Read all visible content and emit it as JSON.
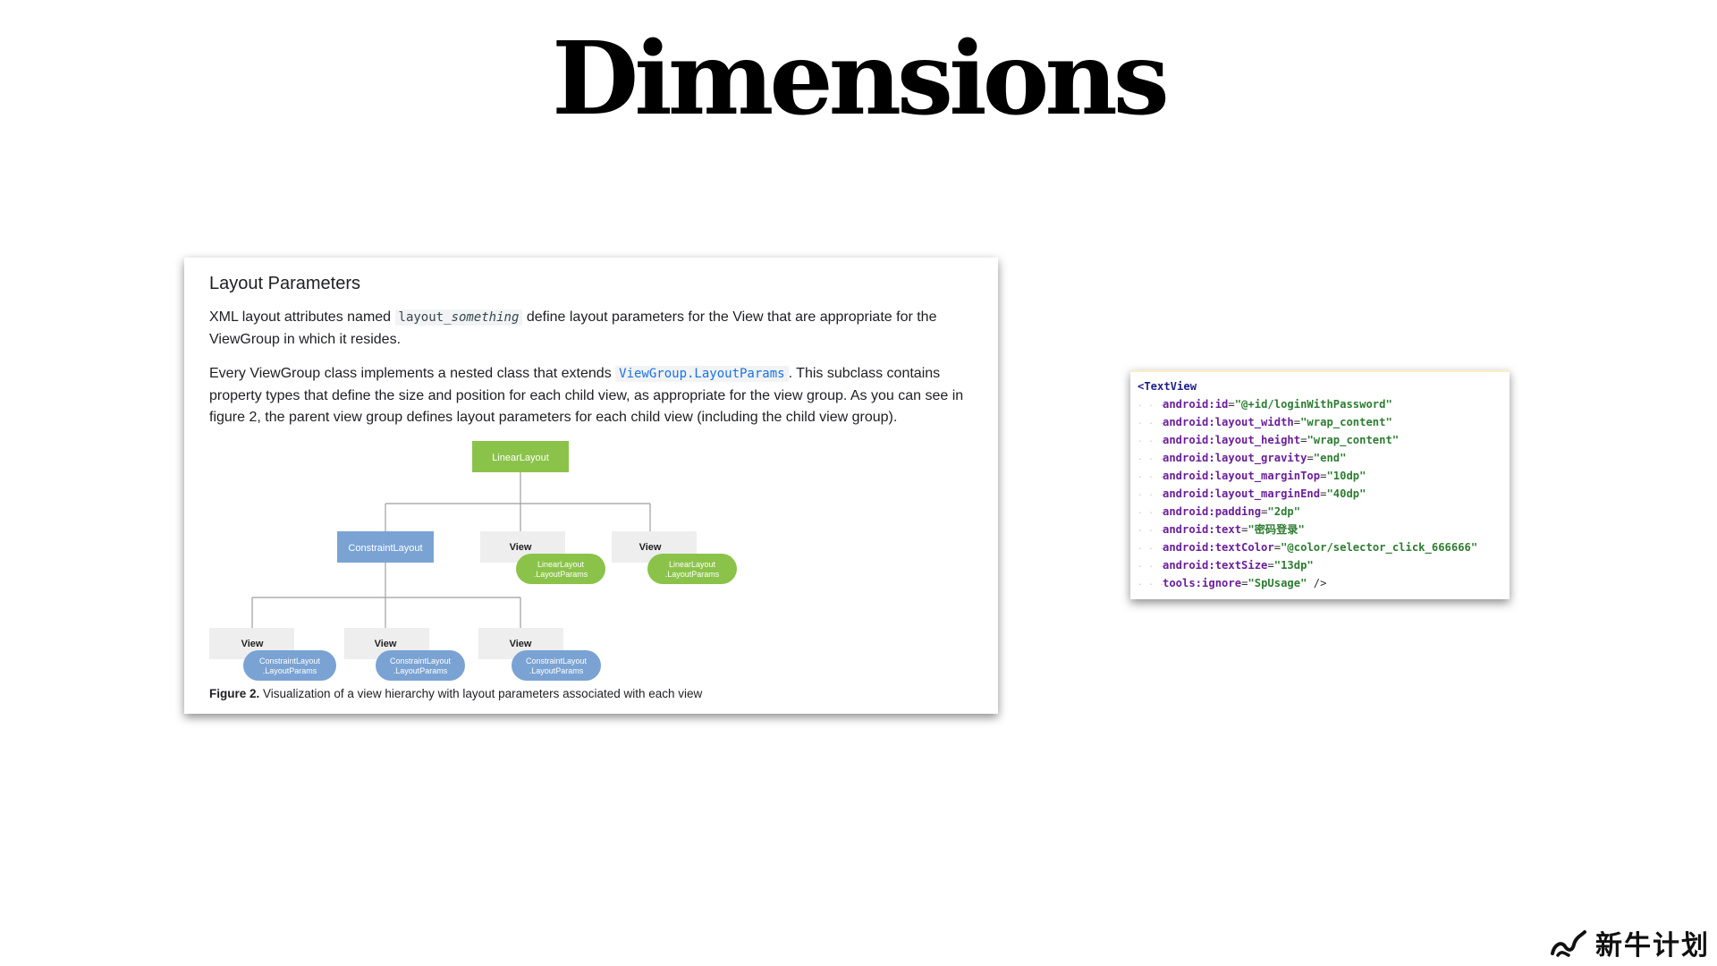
{
  "slide": {
    "title": "Dimensions"
  },
  "doc": {
    "heading": "Layout Parameters",
    "para1_pre": "XML layout attributes named ",
    "para1_code_a": "layout_",
    "para1_code_b": "something",
    "para1_post": " define layout parameters for the View that are appropriate for the ViewGroup in which it resides.",
    "para2_pre": "Every ViewGroup class implements a nested class that extends ",
    "para2_link": "ViewGroup.LayoutParams",
    "para2_post": ". This subclass contains property types that define the size and position for each child view, as appropriate for the view group. As you can see in figure 2, the parent view group defines layout parameters for each child view (including the child view group).",
    "figure": {
      "root": "LinearLayout",
      "constraint": "ConstraintLayout",
      "view": "View",
      "linear_params_1": "LinearLayout",
      "linear_params_2": ".LayoutParams",
      "constraint_params_1": "ConstraintLayout",
      "constraint_params_2": ".LayoutParams",
      "caption_bold": "Figure 2.",
      "caption_text": " Visualization of a view hierarchy with layout parameters associated with each view",
      "colors": {
        "green": "#8bc34a",
        "blue": "#7aa3d4",
        "gray": "#eeeeee",
        "line": "#9e9e9e"
      }
    }
  },
  "code": {
    "open_tag": "<TextView",
    "lines": [
      {
        "attr": "android:id",
        "val": "\"@+id/loginWithPassword\""
      },
      {
        "attr": "android:layout_width",
        "val": "\"wrap_content\""
      },
      {
        "attr": "android:layout_height",
        "val": "\"wrap_content\""
      },
      {
        "attr": "android:layout_gravity",
        "val": "\"end\""
      },
      {
        "attr": "android:layout_marginTop",
        "val": "\"10dp\""
      },
      {
        "attr": "android:layout_marginEnd",
        "val": "\"40dp\""
      },
      {
        "attr": "android:padding",
        "val": "\"2dp\""
      },
      {
        "attr": "android:text",
        "val": "\"密码登录\""
      },
      {
        "attr": "android:textColor",
        "val": "\"@color/selector_click_666666\""
      },
      {
        "attr": "android:textSize",
        "val": "\"13dp\""
      },
      {
        "attr": "tools:ignore",
        "val": "\"SpUsage\""
      }
    ],
    "close": " />",
    "eq": "="
  },
  "logo": {
    "text": "新牛计划",
    "icon": "swirl-logo-icon"
  }
}
